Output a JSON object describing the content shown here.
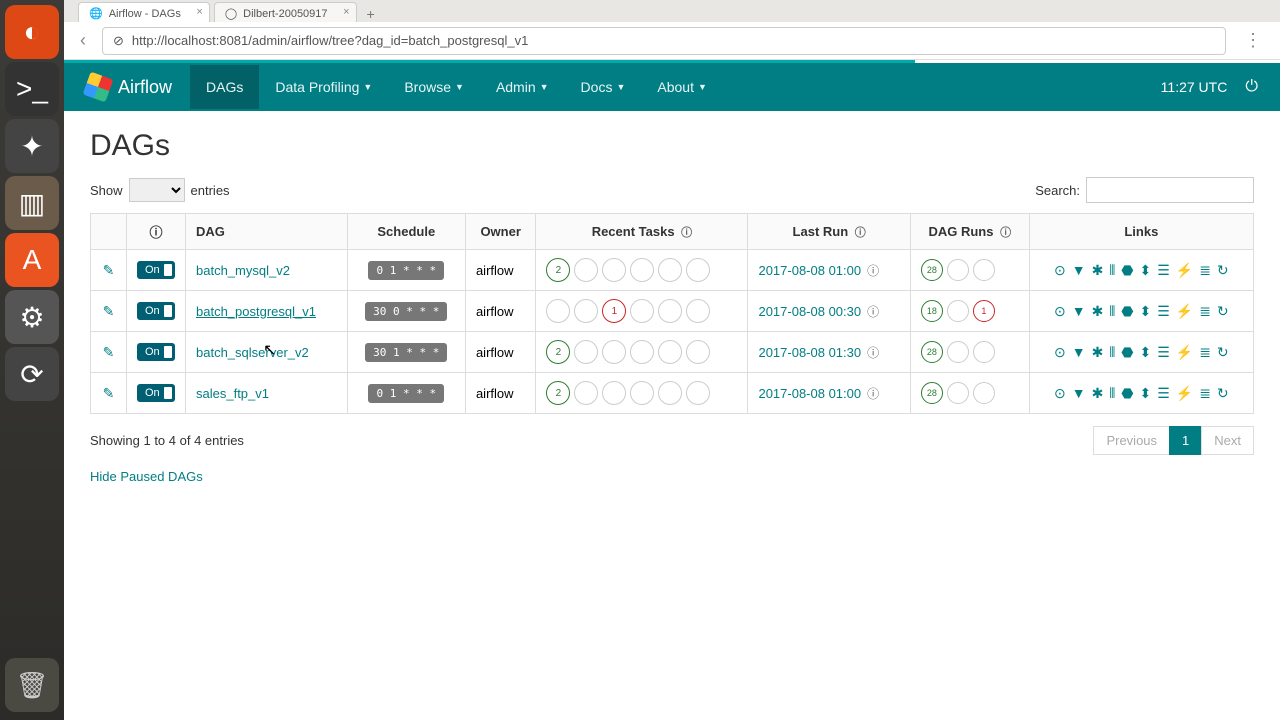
{
  "browser": {
    "tabs": [
      {
        "title": "Airflow - DAGs",
        "active": true
      },
      {
        "title": "Dilbert-20050917",
        "active": false
      }
    ],
    "url": "http://localhost:8081/admin/airflow/tree?dag_id=batch_postgresql_v1"
  },
  "navbar": {
    "brand": "Airflow",
    "items": [
      "DAGs",
      "Data Profiling",
      "Browse",
      "Admin",
      "Docs",
      "About"
    ],
    "activeIndex": 0,
    "clock": "11:27 UTC"
  },
  "page": {
    "heading": "DAGs",
    "show_label": "Show",
    "entries_label": "entries",
    "search_label": "Search:",
    "showing": "Showing 1 to 4 of 4 entries",
    "hide_paused": "Hide Paused DAGs",
    "prev": "Previous",
    "next": "Next",
    "page_num": "1"
  },
  "columns": {
    "dag": "DAG",
    "schedule": "Schedule",
    "owner": "Owner",
    "recent": "Recent Tasks",
    "last": "Last Run",
    "runs": "DAG Runs",
    "links": "Links"
  },
  "rows": [
    {
      "toggle": "On",
      "dag": "batch_mysql_v2",
      "underline": false,
      "schedule": "0 1 * * *",
      "owner": "airflow",
      "recent": [
        {
          "n": "2",
          "cls": "success"
        },
        {
          "n": "",
          "cls": ""
        },
        {
          "n": "",
          "cls": ""
        },
        {
          "n": "",
          "cls": ""
        },
        {
          "n": "",
          "cls": ""
        },
        {
          "n": "",
          "cls": ""
        }
      ],
      "last": "2017-08-08 01:00",
      "info": true,
      "runs": [
        {
          "n": "28",
          "cls": "g"
        },
        {
          "n": "",
          "cls": ""
        },
        {
          "n": "",
          "cls": ""
        }
      ]
    },
    {
      "toggle": "On",
      "dag": "batch_postgresql_v1",
      "underline": true,
      "schedule": "30 0 * * *",
      "owner": "airflow",
      "recent": [
        {
          "n": "",
          "cls": ""
        },
        {
          "n": "",
          "cls": ""
        },
        {
          "n": "1",
          "cls": "fail"
        },
        {
          "n": "",
          "cls": ""
        },
        {
          "n": "",
          "cls": ""
        },
        {
          "n": "",
          "cls": ""
        }
      ],
      "last": "2017-08-08 00:30",
      "info": true,
      "runs": [
        {
          "n": "18",
          "cls": "g"
        },
        {
          "n": "",
          "cls": ""
        },
        {
          "n": "1",
          "cls": "r"
        }
      ]
    },
    {
      "toggle": "On",
      "dag": "batch_sqlserver_v2",
      "underline": false,
      "schedule": "30 1 * * *",
      "owner": "airflow",
      "recent": [
        {
          "n": "2",
          "cls": "success"
        },
        {
          "n": "",
          "cls": ""
        },
        {
          "n": "",
          "cls": ""
        },
        {
          "n": "",
          "cls": ""
        },
        {
          "n": "",
          "cls": ""
        },
        {
          "n": "",
          "cls": ""
        }
      ],
      "last": "2017-08-08 01:30",
      "info": true,
      "runs": [
        {
          "n": "28",
          "cls": "g"
        },
        {
          "n": "",
          "cls": ""
        },
        {
          "n": "",
          "cls": ""
        }
      ]
    },
    {
      "toggle": "On",
      "dag": "sales_ftp_v1",
      "underline": false,
      "schedule": "0 1 * * *",
      "owner": "airflow",
      "recent": [
        {
          "n": "2",
          "cls": "success"
        },
        {
          "n": "",
          "cls": ""
        },
        {
          "n": "",
          "cls": ""
        },
        {
          "n": "",
          "cls": ""
        },
        {
          "n": "",
          "cls": ""
        },
        {
          "n": "",
          "cls": ""
        }
      ],
      "last": "2017-08-08 01:00",
      "info": true,
      "runs": [
        {
          "n": "28",
          "cls": "g"
        },
        {
          "n": "",
          "cls": ""
        },
        {
          "n": "",
          "cls": ""
        }
      ]
    }
  ],
  "link_icons": [
    "⊙",
    "▼",
    "✱",
    "⫴",
    "⬣",
    "⬍",
    "☰",
    "⚡",
    "≣",
    "↻"
  ]
}
